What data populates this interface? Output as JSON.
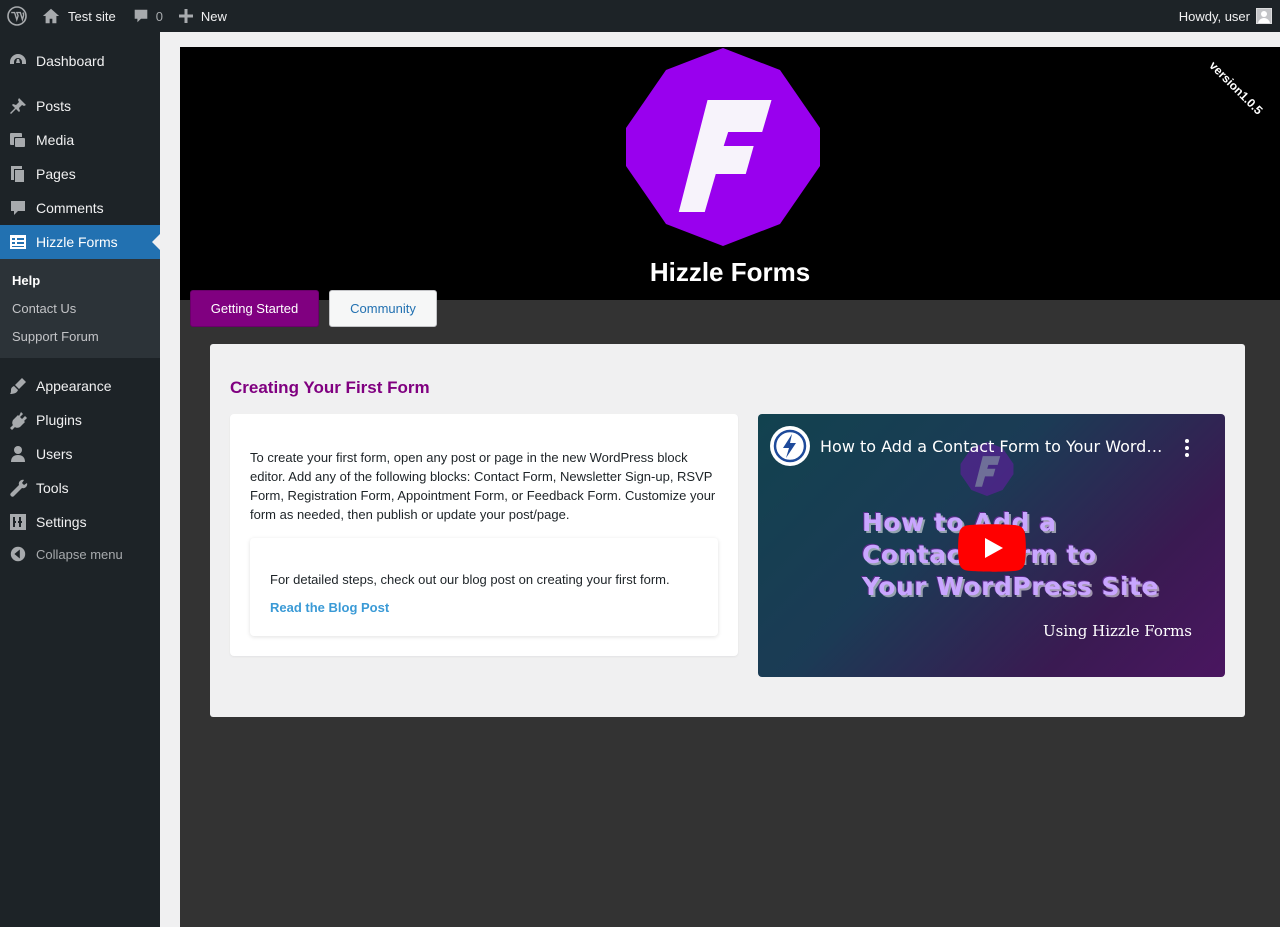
{
  "adminbar": {
    "site_name": "Test site",
    "comments_count": "0",
    "new_label": "New",
    "greeting": "Howdy, user"
  },
  "sidebar": {
    "items": [
      {
        "label": "Dashboard",
        "icon": "dashboard-icon"
      },
      {
        "label": "Posts",
        "icon": "pin-icon"
      },
      {
        "label": "Media",
        "icon": "media-icon"
      },
      {
        "label": "Pages",
        "icon": "pages-icon"
      },
      {
        "label": "Comments",
        "icon": "comment-icon"
      },
      {
        "label": "Hizzle Forms",
        "icon": "forms-icon"
      },
      {
        "label": "Appearance",
        "icon": "brush-icon"
      },
      {
        "label": "Plugins",
        "icon": "plugin-icon"
      },
      {
        "label": "Users",
        "icon": "user-icon"
      },
      {
        "label": "Tools",
        "icon": "wrench-icon"
      },
      {
        "label": "Settings",
        "icon": "settings-icon"
      }
    ],
    "submenu": [
      "Help",
      "Contact Us",
      "Support Forum"
    ],
    "collapse_label": "Collapse menu"
  },
  "hero": {
    "logo_letter": "F",
    "title": "Hizzle Forms",
    "version": "version1.0.5",
    "brand_color": "#9900ee"
  },
  "tabs": [
    {
      "label": "Getting Started",
      "active": true
    },
    {
      "label": "Community",
      "active": false
    }
  ],
  "panel": {
    "title": "Creating Your First Form",
    "intro": "To create your first form, open any post or page in the new WordPress block editor. Add any of the following blocks: Contact Form, Newsletter Sign-up, RSVP Form, Registration Form, Appointment Form, or Feedback Form. Customize your form as needed, then publish or update your post/page.",
    "detail": "For detailed steps, check out our blog post on creating your first form.",
    "link_label": "Read the Blog Post"
  },
  "video": {
    "title": "How to Add a Contact Form to Your WordPress Site | Hizzle Forms",
    "thumb_lines": [
      "How to Add a",
      "Contact Form to",
      "Your WordPress Site"
    ],
    "thumb_sub": "Using Hizzle Forms"
  },
  "colors": {
    "accent": "#800080",
    "wp_blue": "#2271b1",
    "admin_dark": "#1d2327"
  }
}
